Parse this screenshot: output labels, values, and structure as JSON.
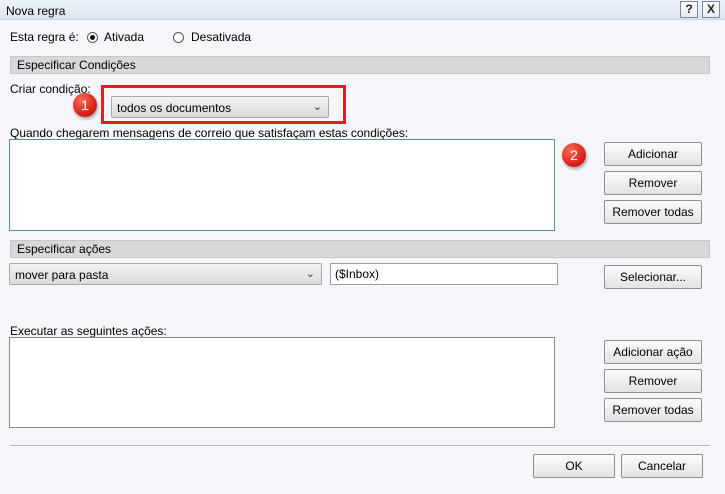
{
  "window": {
    "title": "Nova regra",
    "help_label": "?",
    "close_label": "X"
  },
  "state": {
    "label": "Esta regra é:",
    "enabled_label": "Ativada",
    "disabled_label": "Desativada",
    "selected": "Ativada"
  },
  "conditions": {
    "section_title": "Especificar Condições",
    "create_label": "Criar condição:",
    "condition_value": "todos os documentos",
    "list_label": "Quando chegarem mensagens de correio que satisfaçam estas condições:",
    "buttons": {
      "add": "Adicionar",
      "remove": "Remover",
      "remove_all": "Remover todas"
    }
  },
  "actions": {
    "section_title": "Especificar ações",
    "action_value": "mover para pasta",
    "folder_value": "($Inbox)",
    "select_label": "Selecionar...",
    "list_label": "Executar as seguintes ações:",
    "buttons": {
      "add": "Adicionar ação",
      "remove": "Remover",
      "remove_all": "Remover todas"
    }
  },
  "footer": {
    "ok": "OK",
    "cancel": "Cancelar"
  },
  "annotations": {
    "badge_1": "1",
    "badge_2": "2",
    "highlight_color": "#e02020"
  }
}
